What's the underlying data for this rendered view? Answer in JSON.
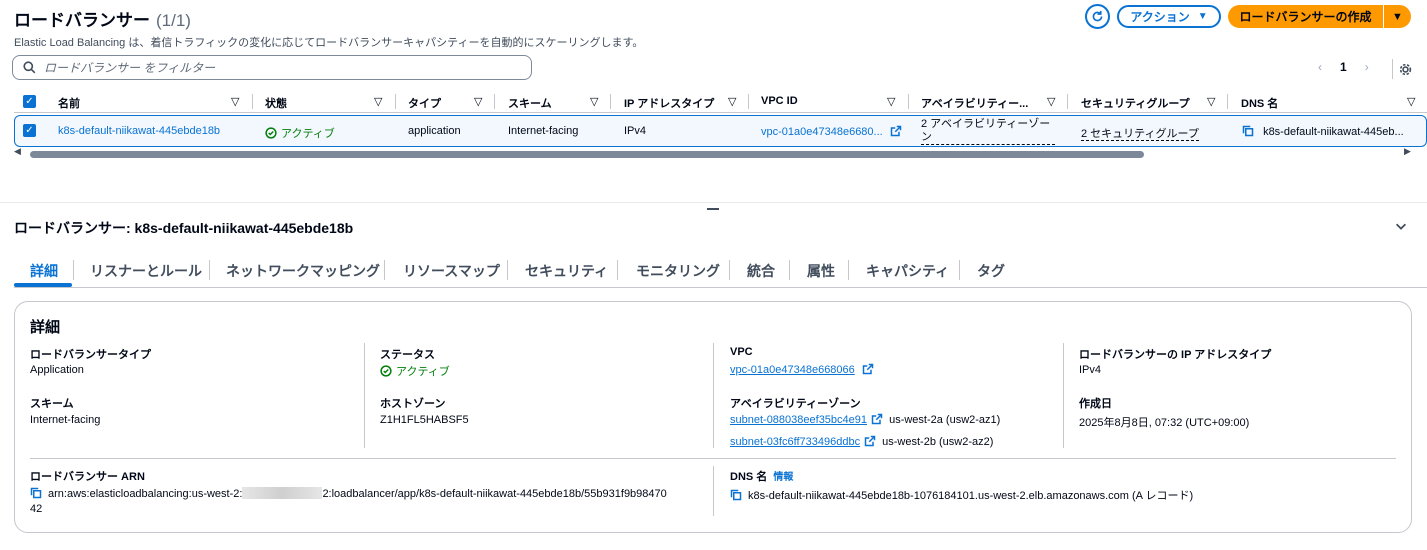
{
  "header": {
    "title": "ロードバランサー",
    "count": "(1/1)",
    "subtitle": "Elastic Load Balancing は、着信トラフィックの変化に応じてロードバランサーキャパシティーを自動的にスケーリングします。",
    "action_label": "アクション",
    "create_label": "ロードバランサーの作成"
  },
  "filter": {
    "placeholder": "ロードバランサー をフィルター"
  },
  "pagination": {
    "page": "1"
  },
  "table": {
    "columns": [
      "名前",
      "状態",
      "タイプ",
      "スキーム",
      "IP アドレスタイプ",
      "VPC ID",
      "アベイラビリティー...",
      "セキュリティグループ",
      "DNS 名"
    ],
    "row": {
      "name": "k8s-default-niikawat-445ebde18b",
      "state": "アクティブ",
      "type": "application",
      "scheme": "Internet-facing",
      "ip_type": "IPv4",
      "vpc_id": "vpc-01a0e47348e6680...",
      "az_line1": "2 アベイラビリティーゾー",
      "az_line2": "ン",
      "security_groups": "2 セキュリティグループ",
      "dns": "k8s-default-niikawat-445eb..."
    }
  },
  "detail": {
    "title": "ロードバランサー: k8s-default-niikawat-445ebde18b",
    "tabs": [
      "詳細",
      "リスナーとルール",
      "ネットワークマッピング",
      "リソースマップ",
      "セキュリティ",
      "モニタリング",
      "統合",
      "属性",
      "キャパシティ",
      "タグ"
    ],
    "panel_title": "詳細",
    "lb_type_label": "ロードバランサータイプ",
    "lb_type_value": "Application",
    "scheme_label": "スキーム",
    "scheme_value": "Internet-facing",
    "status_label": "ステータス",
    "status_value": "アクティブ",
    "hosted_zone_label": "ホストゾーン",
    "hosted_zone_value": "Z1H1FL5HABSF5",
    "vpc_label": "VPC",
    "vpc_value": "vpc-01a0e47348e668066",
    "az_label": "アベイラビリティーゾーン",
    "subnet1": "subnet-088038eef35bc4e91",
    "subnet1_zone": "us-west-2a (usw2-az1)",
    "subnet2": "subnet-03fc6ff733496ddbc",
    "subnet2_zone": "us-west-2b (usw2-az2)",
    "ip_type_label": "ロードバランサーの IP アドレスタイプ",
    "ip_type_value": "IPv4",
    "created_label": "作成日",
    "created_value": "2025年8月8日, 07:32 (UTC+09:00)",
    "arn_label": "ロードバランサー ARN",
    "arn_prefix": "arn:aws:elasticloadbalancing:us-west-2:",
    "arn_suffix": "2:loadbalancer/app/k8s-default-niikawat-445ebde18b/55b931f9b98470",
    "arn_tail": "42",
    "dns_label": "DNS 名",
    "dns_info": "情報",
    "dns_value": "k8s-default-niikawat-445ebde18b-1076184101.us-west-2.elb.amazonaws.com (A レコード)"
  },
  "colors": {
    "accent": "#0972d3",
    "primary_button": "#ff9900",
    "success": "#037f0c"
  }
}
